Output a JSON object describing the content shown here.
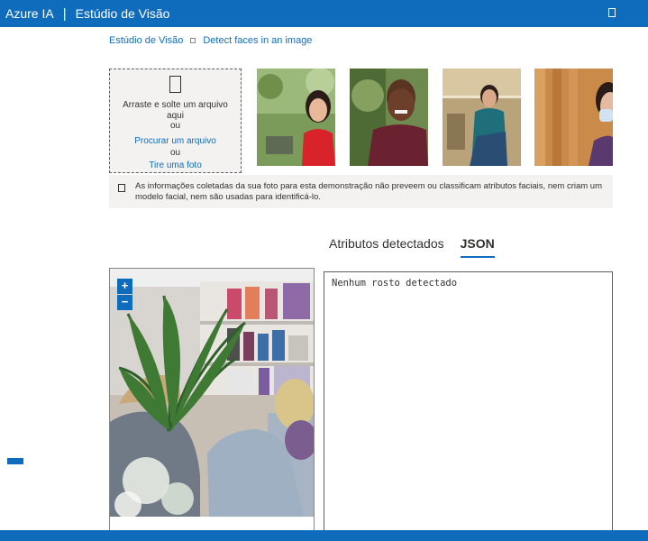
{
  "header": {
    "brand": "Azure IA",
    "separator": "|",
    "app_title": "Estúdio de Visão",
    "icon": "window-icon"
  },
  "breadcrumb": {
    "home": "Estúdio de Visão",
    "current": "Detect faces in an image"
  },
  "upload": {
    "icon": "file-icon",
    "drag_text": "Arraste e solte um arquivo aqui",
    "or_1": "ou",
    "browse_link": "Procurar um arquivo",
    "or_2": "ou",
    "photo_link": "Tire uma foto"
  },
  "samples": [
    {
      "name": "sample-image-woman-smiling"
    },
    {
      "name": "sample-image-man-smiling"
    },
    {
      "name": "sample-image-woman-shopping"
    },
    {
      "name": "sample-image-woman-mask"
    }
  ],
  "notice": {
    "icon": "info-icon",
    "text": "As informações coletadas da sua foto para esta demonstração não preveem ou classificam atributos faciais, nem criam um modelo facial, nem são usadas para identificá-lo."
  },
  "tabs": [
    {
      "label": "Atributos detectados",
      "active": false
    },
    {
      "label": "JSON",
      "active": true
    }
  ],
  "viewer": {
    "zoom_in": "+",
    "zoom_out": "−"
  },
  "json_output": {
    "text": "Nenhum rosto detectado"
  },
  "colors": {
    "accent": "#0f6cbd",
    "panel_bg": "#f3f2f1"
  }
}
